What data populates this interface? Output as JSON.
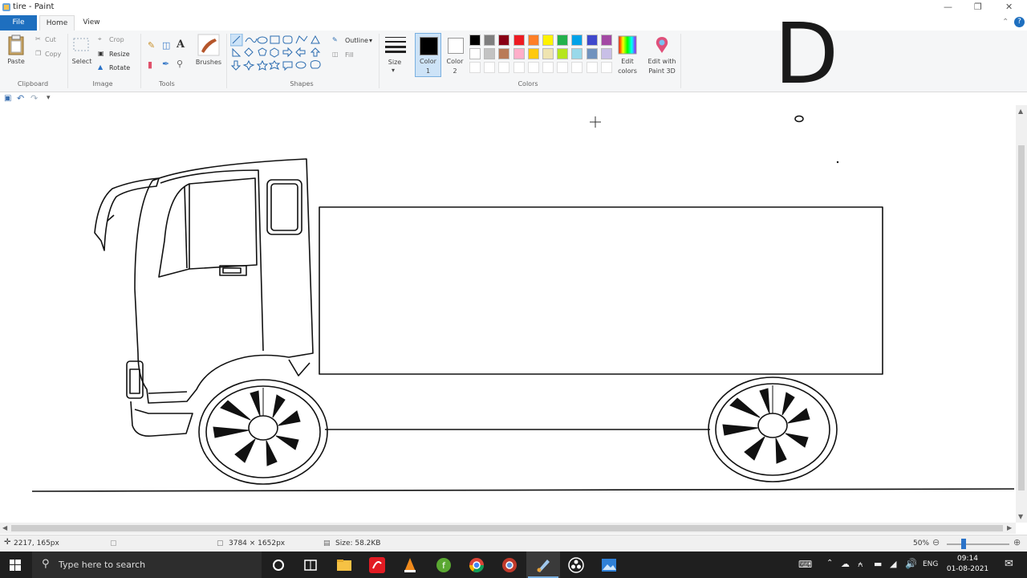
{
  "window": {
    "title": "tire - Paint"
  },
  "tabs": {
    "file": "File",
    "home": "Home",
    "view": "View"
  },
  "clipboard": {
    "paste": "Paste",
    "cut": "Cut",
    "copy": "Copy",
    "label": "Clipboard"
  },
  "image": {
    "select": "Select",
    "crop": "Crop",
    "resize": "Resize",
    "rotate": "Rotate",
    "label": "Image"
  },
  "tools": {
    "label": "Tools",
    "brushes": "Brushes"
  },
  "shapes": {
    "outline": "Outline",
    "fill": "Fill",
    "label": "Shapes"
  },
  "size": {
    "label": "Size"
  },
  "colors": {
    "color1_line1": "Color",
    "color1_line2": "1",
    "color2_line1": "Color",
    "color2_line2": "2",
    "edit_line1": "Edit",
    "edit_line2": "colors",
    "paint3d_line1": "Edit with",
    "paint3d_line2": "Paint 3D",
    "label": "Colors",
    "palette_row1": [
      "#000000",
      "#7f7f7f",
      "#880015",
      "#ed1c24",
      "#ff7f27",
      "#fff200",
      "#22b14c",
      "#00a2e8",
      "#3f48cc",
      "#a349a4"
    ],
    "palette_row2": [
      "#ffffff",
      "#c3c3c3",
      "#b97a57",
      "#ffaec9",
      "#ffc90e",
      "#efe4b0",
      "#b5e61d",
      "#99d9ea",
      "#7092be",
      "#c8bfe7"
    ],
    "accent": "#1e6fbf"
  },
  "overlay": {
    "letter": "D"
  },
  "status": {
    "cursor_pos": "2217, 165px",
    "image_size": "3784 × 1652px",
    "file_size": "Size: 58.2KB",
    "zoom": "50%"
  },
  "taskbar": {
    "search_placeholder": "Type here to search",
    "lang": "ENG",
    "time": "09:14",
    "date": "01-08-2021"
  }
}
